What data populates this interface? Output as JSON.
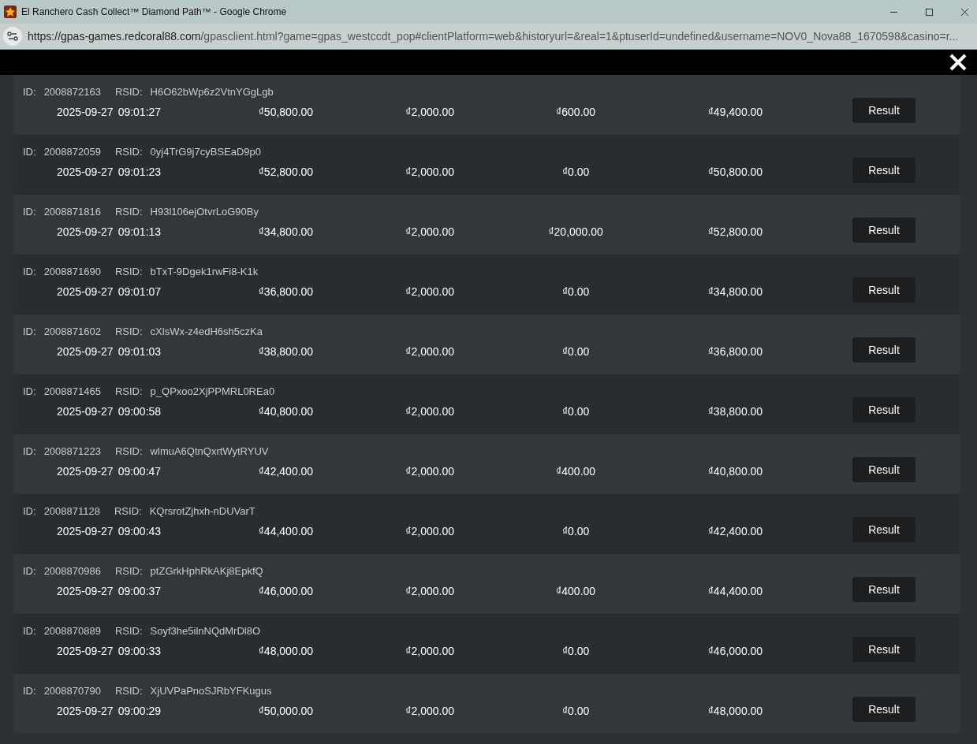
{
  "window": {
    "title": "El Ranchero Cash Collect™ Diamond Path™ - Google Chrome"
  },
  "address_bar": {
    "host": "https://gpas-games.redcoral88.com",
    "path": "/gpasclient.html?game=gpas_westccdt_pop#clientPlatform=web&historyurl=&real=1&ptuserId=undefined&username=NOV0_Nova88_1670598&casino=r..."
  },
  "rows": [
    {
      "id_label": "ID:",
      "id": "2008872163",
      "rsid_label": "RSID:",
      "rsid": "H6O62bWp6z2VtnYGgLgb",
      "date": "2025-09-27",
      "time": "09:01:27",
      "start": "₫50,800.00",
      "bet": "₫2,000.00",
      "win": "₫600.00",
      "end": "₫49,400.00",
      "button": "Result"
    },
    {
      "id_label": "ID:",
      "id": "2008872059",
      "rsid_label": "RSID:",
      "rsid": "0yj4TrG9j7cyBSEaD9p0",
      "date": "2025-09-27",
      "time": "09:01:23",
      "start": "₫52,800.00",
      "bet": "₫2,000.00",
      "win": "₫0.00",
      "end": "₫50,800.00",
      "button": "Result"
    },
    {
      "id_label": "ID:",
      "id": "2008871816",
      "rsid_label": "RSID:",
      "rsid": "H93l106ejOtvrLoG90By",
      "date": "2025-09-27",
      "time": "09:01:13",
      "start": "₫34,800.00",
      "bet": "₫2,000.00",
      "win": "₫20,000.00",
      "end": "₫52,800.00",
      "button": "Result"
    },
    {
      "id_label": "ID:",
      "id": "2008871690",
      "rsid_label": "RSID:",
      "rsid": "bTxT-9Dgek1rwFi8-K1k",
      "date": "2025-09-27",
      "time": "09:01:07",
      "start": "₫36,800.00",
      "bet": "₫2,000.00",
      "win": "₫0.00",
      "end": "₫34,800.00",
      "button": "Result"
    },
    {
      "id_label": "ID:",
      "id": "2008871602",
      "rsid_label": "RSID:",
      "rsid": "cXlsWx-z4edH6sh5czKa",
      "date": "2025-09-27",
      "time": "09:01:03",
      "start": "₫38,800.00",
      "bet": "₫2,000.00",
      "win": "₫0.00",
      "end": "₫36,800.00",
      "button": "Result"
    },
    {
      "id_label": "ID:",
      "id": "2008871465",
      "rsid_label": "RSID:",
      "rsid": "p_QPxoo2XjPPMRL0REa0",
      "date": "2025-09-27",
      "time": "09:00:58",
      "start": "₫40,800.00",
      "bet": "₫2,000.00",
      "win": "₫0.00",
      "end": "₫38,800.00",
      "button": "Result"
    },
    {
      "id_label": "ID:",
      "id": "2008871223",
      "rsid_label": "RSID:",
      "rsid": "wlmuA6QtnQxrtWytRYUV",
      "date": "2025-09-27",
      "time": "09:00:47",
      "start": "₫42,400.00",
      "bet": "₫2,000.00",
      "win": "₫400.00",
      "end": "₫40,800.00",
      "button": "Result"
    },
    {
      "id_label": "ID:",
      "id": "2008871128",
      "rsid_label": "RSID:",
      "rsid": "KQrsrotZjhxh-nDUVarT",
      "date": "2025-09-27",
      "time": "09:00:43",
      "start": "₫44,400.00",
      "bet": "₫2,000.00",
      "win": "₫0.00",
      "end": "₫42,400.00",
      "button": "Result"
    },
    {
      "id_label": "ID:",
      "id": "2008870986",
      "rsid_label": "RSID:",
      "rsid": "ptZGrkHphRkAKj8EpkfQ",
      "date": "2025-09-27",
      "time": "09:00:37",
      "start": "₫46,000.00",
      "bet": "₫2,000.00",
      "win": "₫400.00",
      "end": "₫44,400.00",
      "button": "Result"
    },
    {
      "id_label": "ID:",
      "id": "2008870889",
      "rsid_label": "RSID:",
      "rsid": "Soyf3he5ilnNQdMrDl8O",
      "date": "2025-09-27",
      "time": "09:00:33",
      "start": "₫48,000.00",
      "bet": "₫2,000.00",
      "win": "₫0.00",
      "end": "₫46,000.00",
      "button": "Result"
    },
    {
      "id_label": "ID:",
      "id": "2008870790",
      "rsid_label": "RSID:",
      "rsid": "XjUVPaPnoSJRbYFKugus",
      "date": "2025-09-27",
      "time": "09:00:29",
      "start": "₫50,000.00",
      "bet": "₫2,000.00",
      "win": "₫0.00",
      "end": "₫48,000.00",
      "button": "Result"
    }
  ]
}
